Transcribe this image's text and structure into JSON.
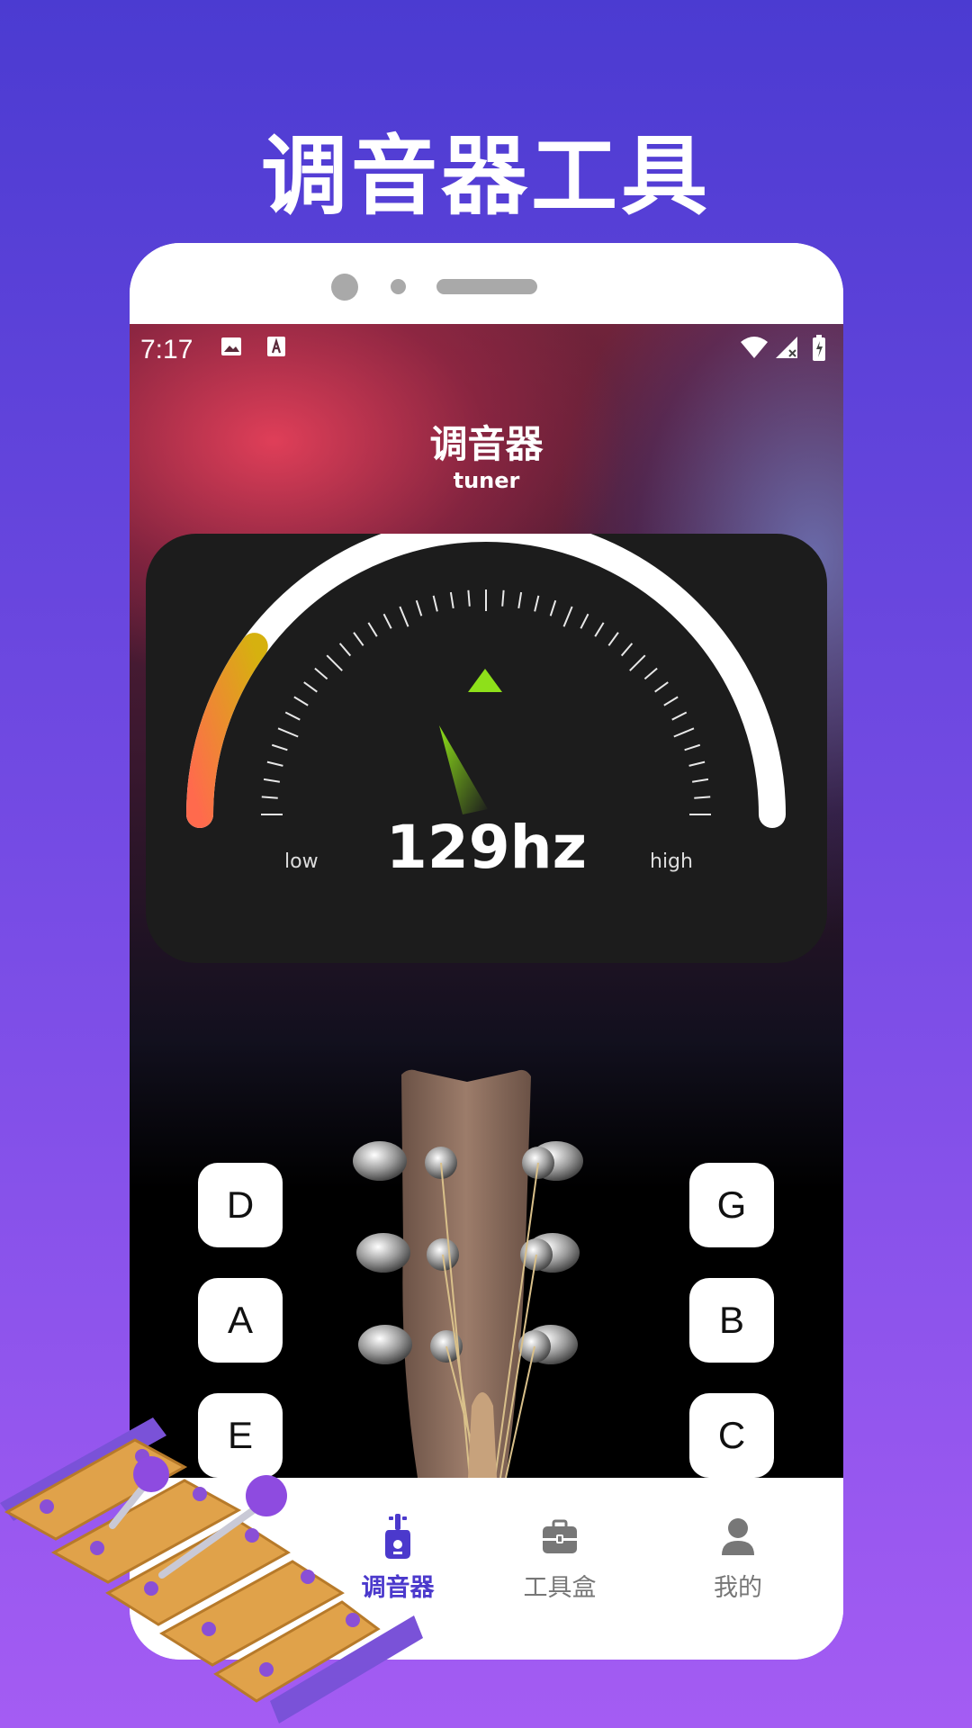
{
  "promo": {
    "title": "调音器工具"
  },
  "status_bar": {
    "time": "7:17"
  },
  "app": {
    "title": "调音器",
    "subtitle": "tuner"
  },
  "tuner": {
    "frequency": "129hz",
    "low_label": "low",
    "high_label": "high",
    "progress_fraction": 0.2
  },
  "strings": {
    "left": [
      "D",
      "A",
      "E"
    ],
    "right": [
      "G",
      "B",
      "C"
    ]
  },
  "tabbar": {
    "items": [
      {
        "label": "调音器",
        "icon": "guitar-icon",
        "active": true
      },
      {
        "label": "工具盒",
        "icon": "briefcase-icon",
        "active": false
      },
      {
        "label": "我的",
        "icon": "user-icon",
        "active": false
      }
    ]
  },
  "colors": {
    "accent": "#4b39cc",
    "needle": "#8ee01a",
    "arc_warm_start": "#ff6a4d",
    "arc_warm_end": "#d6b10f"
  }
}
